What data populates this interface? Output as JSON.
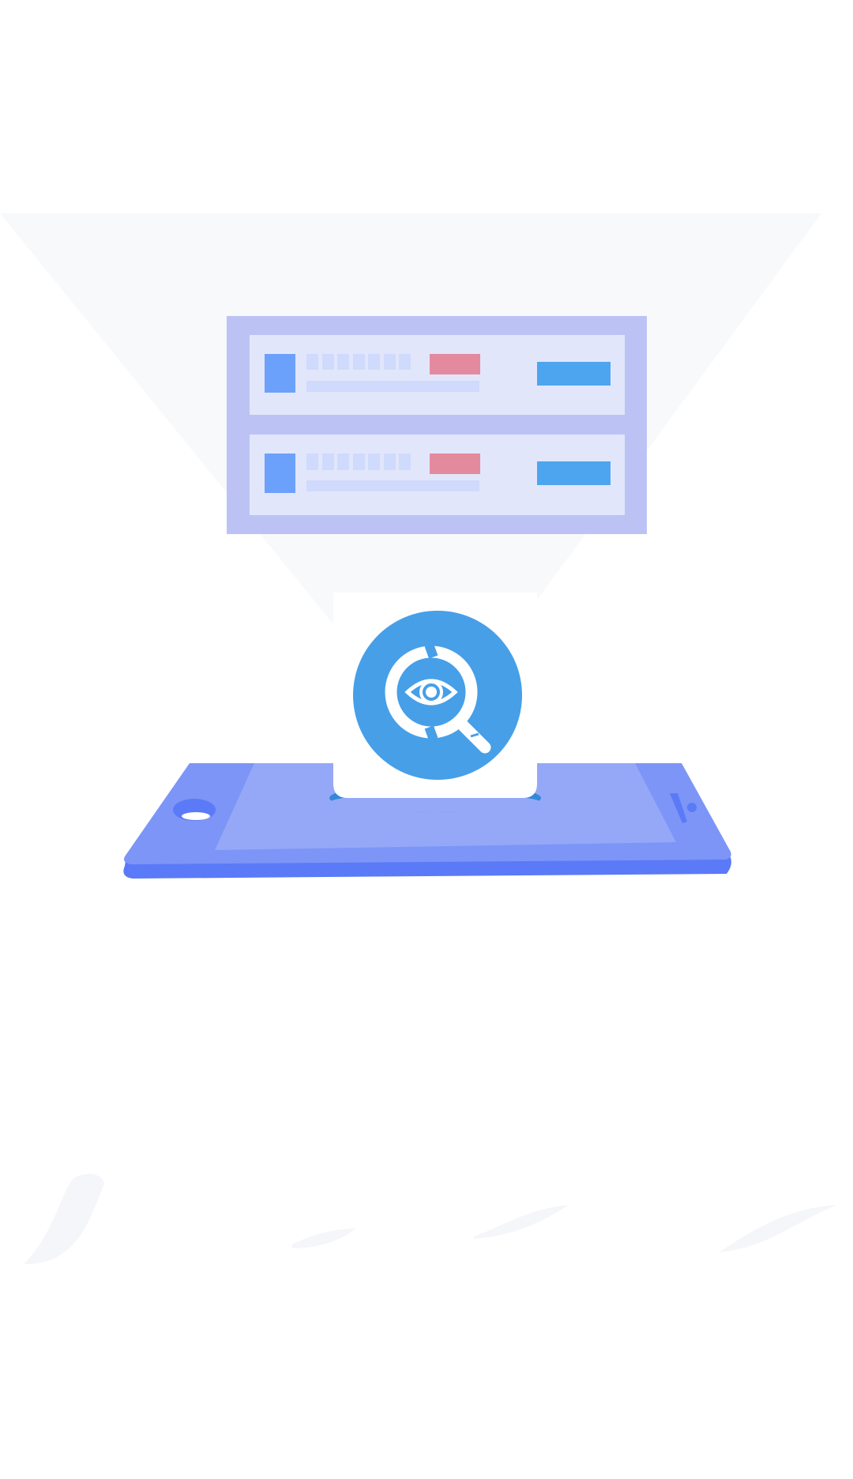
{
  "illustration": {
    "subject": "phone-projecting-server-with-eye-search-icon",
    "icons": [
      "server-rack-icon",
      "magnifier-eye-icon",
      "phone-icon"
    ],
    "colors": {
      "background": "#ffffff",
      "beam": "#f8f9fb",
      "server_frame": "#bcc3f4",
      "server_panel": "#e2e6fb",
      "server_indicator_blue": "#6ca1fb",
      "server_dots": "#cfdafc",
      "server_indicator_red": "#e48a9e",
      "server_button": "#4ea5ef",
      "badge_circle": "#479fe8",
      "badge_card": "#ffffff",
      "phone_body": "#7c95f7",
      "phone_screen": "#95a8f8",
      "phone_edge": "#5b7af7",
      "phone_slot": "#3289d8",
      "ground_swoosh": "#f5f6f9"
    }
  }
}
